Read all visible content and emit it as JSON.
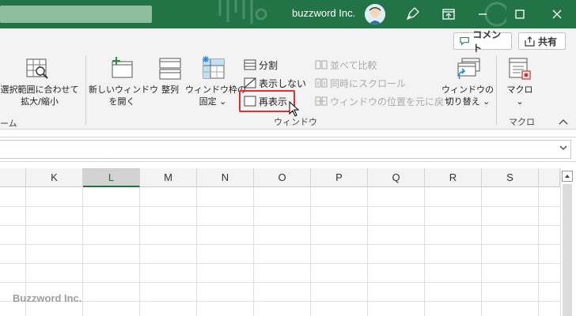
{
  "titlebar": {
    "account": "buzzword Inc.",
    "icons": [
      "avatar-icon",
      "pen-icon",
      "ribbon-display-icon",
      "minimize-icon",
      "maximize-icon",
      "close-icon"
    ]
  },
  "ribbon": {
    "comment_label": "コメント",
    "share_label": "共有",
    "zoom_group": {
      "selection_zoom_label_1": "選択範囲に合わせて",
      "selection_zoom_label_2": "拡大/縮小",
      "group_label_fragment": "ーム"
    },
    "window_group": {
      "new_window_1": "新しいウィンドウ",
      "new_window_2": "を開く",
      "arrange": "整列",
      "freeze_1": "ウィンドウ枠の",
      "freeze_2": "固定 ⌄",
      "split": "分割",
      "hide": "表示しない",
      "unhide": "再表示",
      "side_by_side": "並べて比較",
      "sync_scroll": "同時にスクロール",
      "reset_position": "ウィンドウの位置を元に戻す",
      "switch_1": "ウィンドウの",
      "switch_2": "切り替え ⌄",
      "group_label": "ウィンドウ"
    },
    "macro_group": {
      "macro_label": "マクロ",
      "macro_dropdown": "⌄",
      "group_label": "マクロ"
    }
  },
  "grid": {
    "columns": [
      "K",
      "L",
      "M",
      "N",
      "O",
      "P",
      "Q",
      "R",
      "S"
    ],
    "selected_column": "L"
  },
  "watermark": "Buzzword Inc.",
  "colors": {
    "titlebar": "#227447",
    "accent_green": "#217346",
    "highlight_red": "#e03030"
  }
}
